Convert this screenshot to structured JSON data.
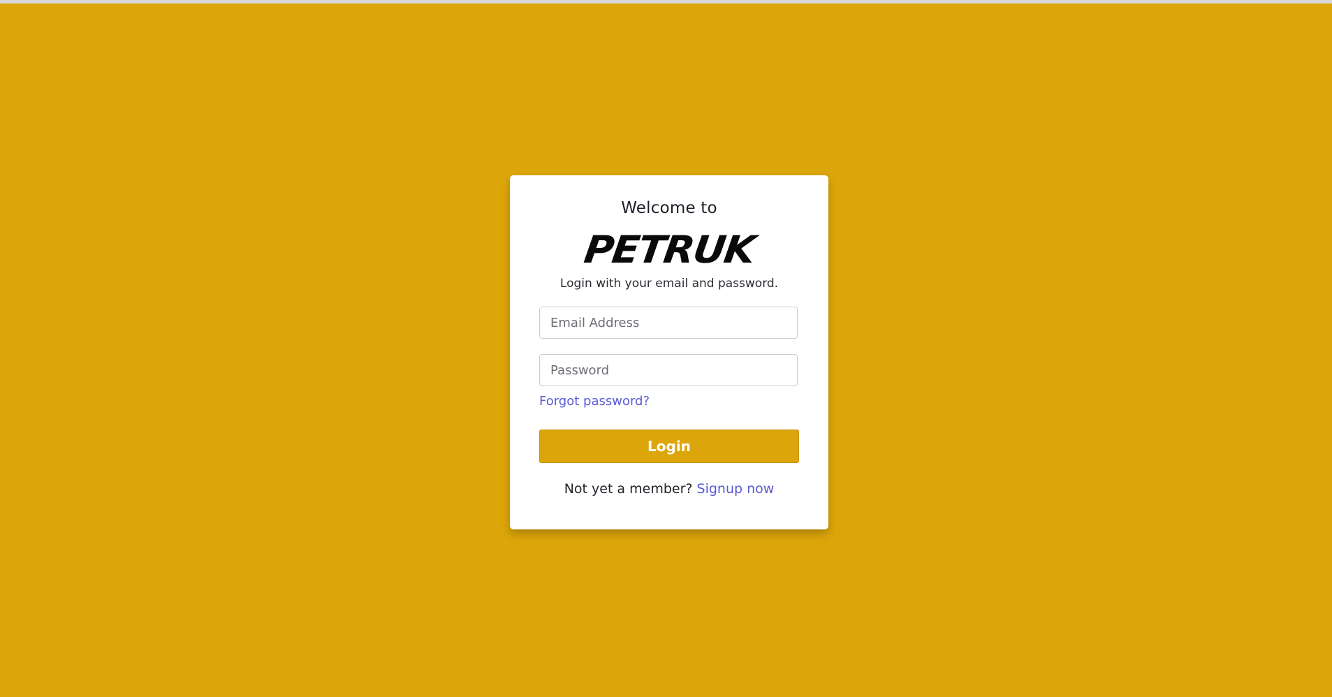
{
  "login_card": {
    "welcome_text": "Welcome to",
    "brand_logo_text": "PETRUK",
    "subtitle": "Login with your email and password.",
    "email_placeholder": "Email Address",
    "email_value": "",
    "password_placeholder": "Password",
    "password_value": "",
    "forgot_password_link": "Forgot password?",
    "login_button_label": "Login",
    "signup_prompt": "Not yet a member?",
    "signup_link": "Signup now"
  },
  "colors": {
    "background": "#DCA50A",
    "button": "#DCA50A",
    "link": "#5A5AD6",
    "card": "#FFFFFF"
  }
}
